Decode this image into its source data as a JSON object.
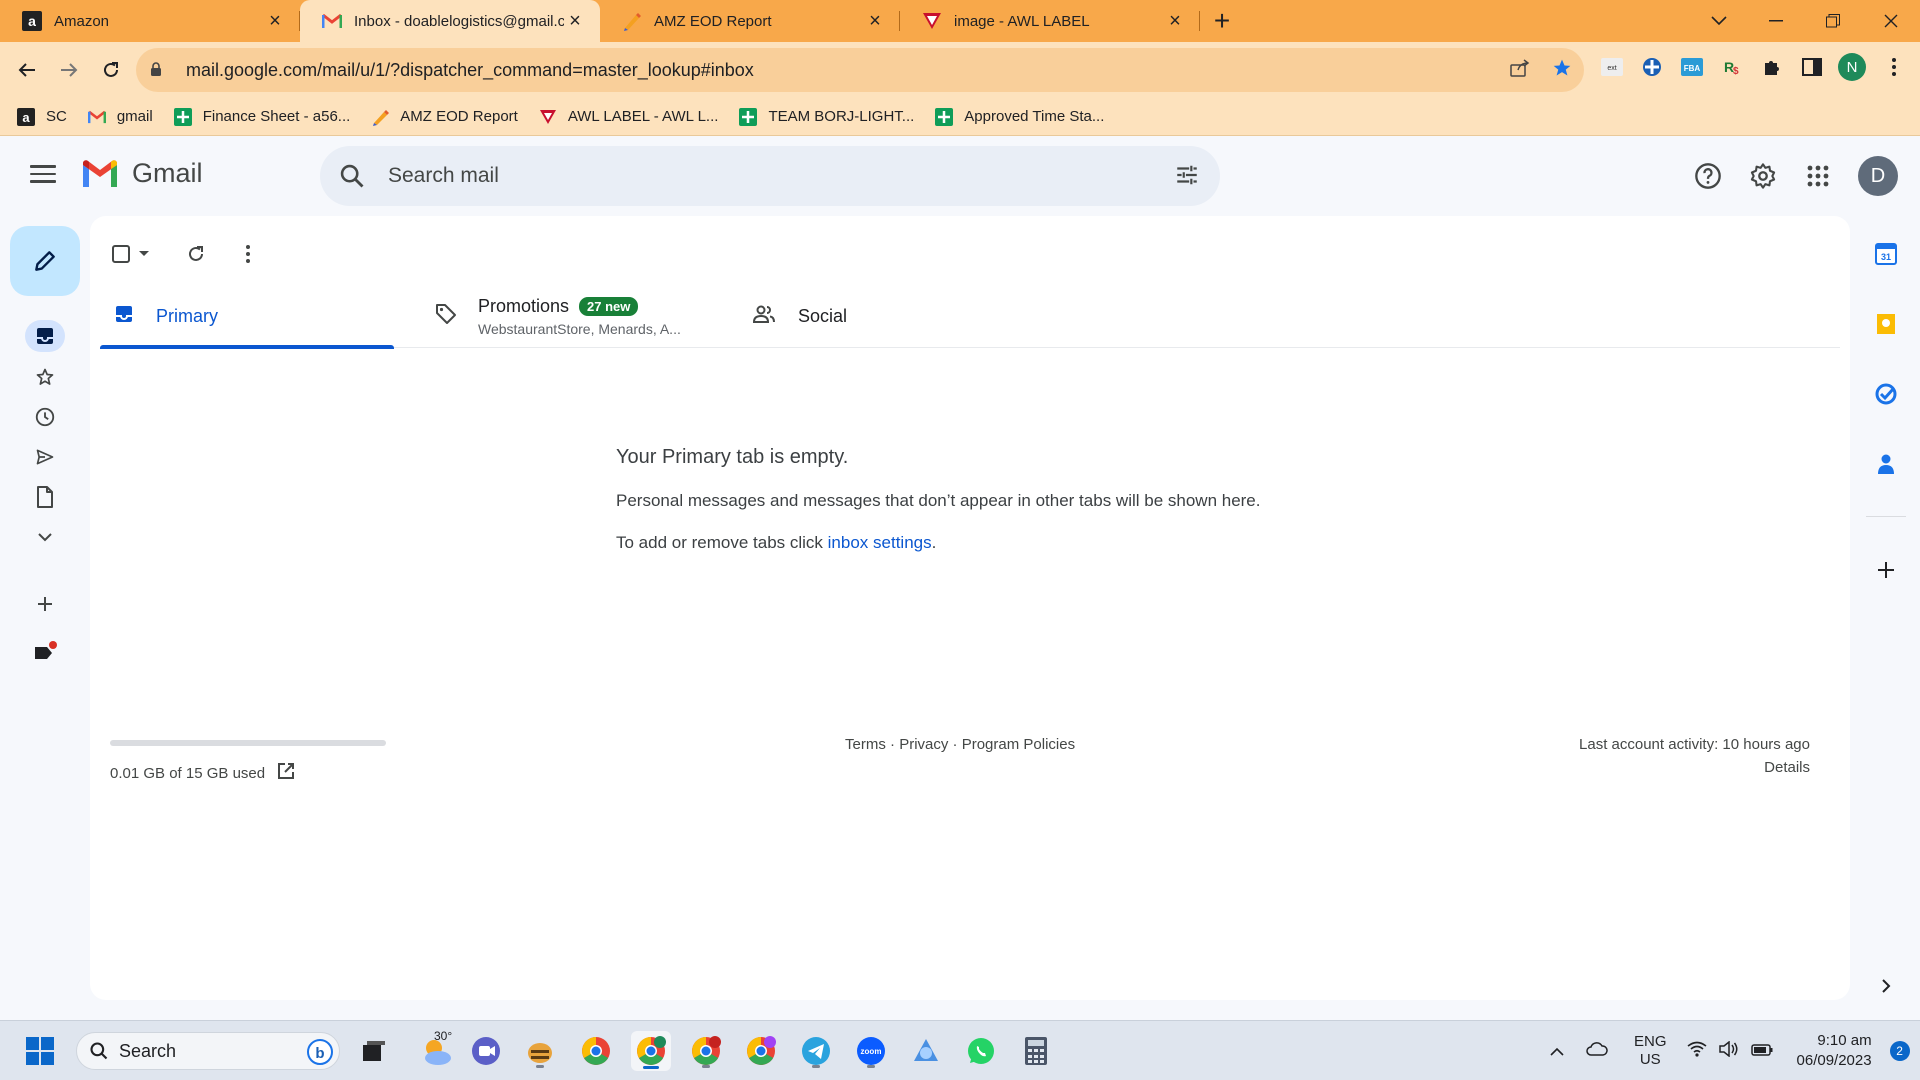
{
  "browser": {
    "tabs": [
      {
        "title": "Amazon",
        "icon": "amazon-icon"
      },
      {
        "title": "Inbox - doablelogistics@gmail.co",
        "icon": "gmail-icon",
        "active": true
      },
      {
        "title": "AMZ EOD Report",
        "icon": "pen-icon"
      },
      {
        "title": "image - AWL LABEL",
        "icon": "awl-icon"
      }
    ],
    "url": "mail.google.com/mail/u/1/?dispatcher_command=master_lookup#inbox",
    "profile_initial": "N",
    "bookmarks": [
      "SC",
      "gmail",
      "Finance Sheet - a56...",
      "AMZ EOD Report",
      "AWL LABEL - AWL L...",
      "TEAM BORJ-LIGHT...",
      "Approved Time Sta..."
    ]
  },
  "gmail": {
    "logo_text": "Gmail",
    "search_placeholder": "Search mail",
    "avatar_initial": "D",
    "tabs": {
      "primary": "Primary",
      "promotions": "Promotions",
      "promotions_badge": "27 new",
      "promotions_sub": "WebstaurantStore, Menards, A...",
      "social": "Social"
    },
    "empty": {
      "title": "Your Primary tab is empty.",
      "line1": "Personal messages and messages that don’t appear in other tabs will be shown here.",
      "line2_prefix": "To add or remove tabs click ",
      "line2_link": "inbox settings",
      "line2_suffix": "."
    },
    "footer": {
      "storage": "0.01 GB of 15 GB used",
      "terms": "Terms",
      "privacy": "Privacy",
      "policies": "Program Policies",
      "sep": " · ",
      "activity": "Last account activity: 10 hours ago",
      "details": "Details"
    }
  },
  "taskbar": {
    "search": "Search",
    "weather": "30°",
    "lang1": "ENG",
    "lang2": "US",
    "time": "9:10 am",
    "date": "06/09/2023",
    "notif_count": "2"
  },
  "colors": {
    "tabstrip": "#f8a84a",
    "toolbar": "#fde2bd",
    "accent": "#0b57d0",
    "badge": "#188038"
  }
}
